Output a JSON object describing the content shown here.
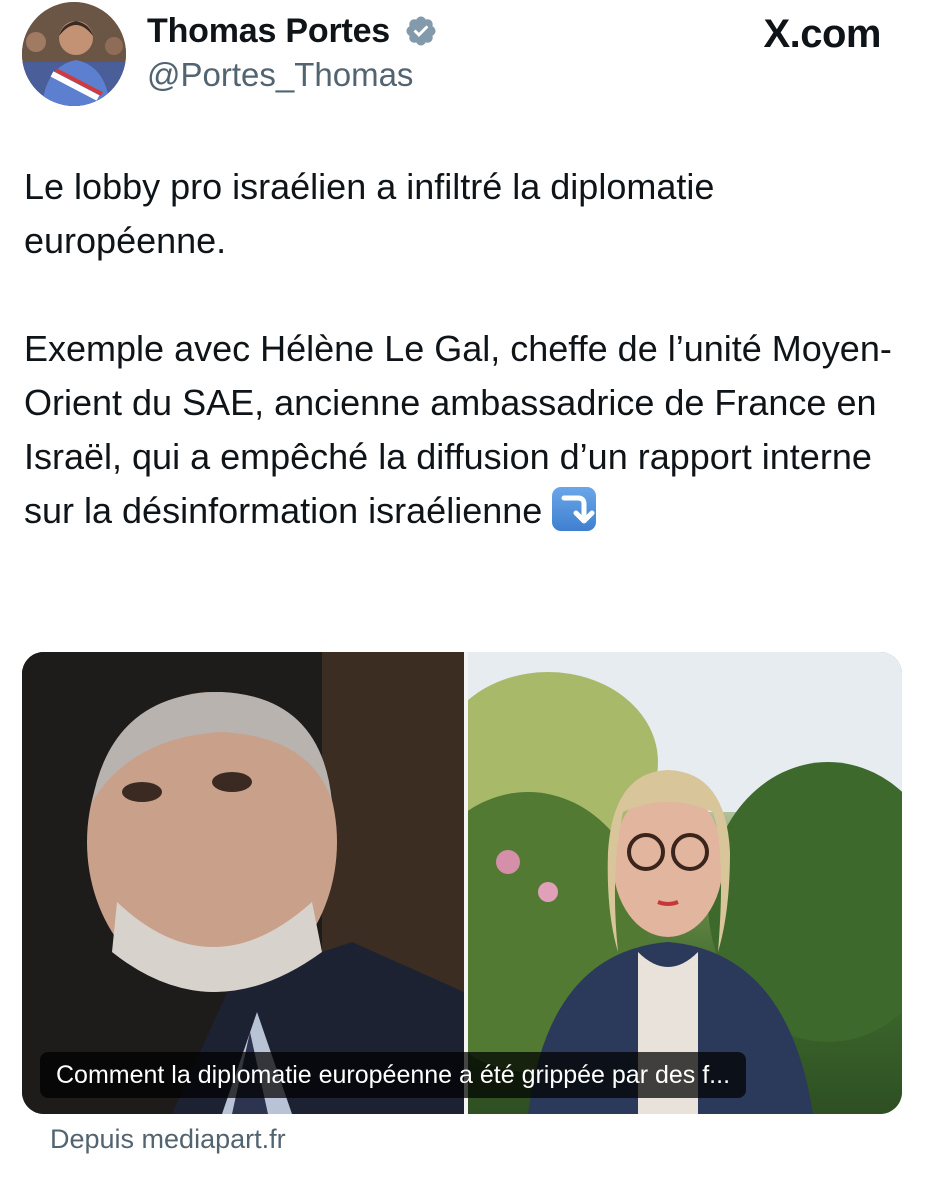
{
  "header": {
    "display_name": "Thomas Portes",
    "handle": "@Portes_Thomas",
    "site_logo": "X.com",
    "verified": true,
    "verified_icon": "verified-badge-icon"
  },
  "tweet": {
    "paragraph1": "Le lobby pro israélien a infiltré la diplomatie européenne.",
    "paragraph2": "Exemple avec Hélène Le Gal, cheffe de l’unité Moyen-Orient du SAE, ancienne ambassadrice de France en Israël, qui a empêché la diffusion d’un rapport interne sur la désinformation israélienne",
    "trailing_emoji": "arrow-curving-down-emoji"
  },
  "link_card": {
    "caption": "Comment la diplomatie européenne a été grippée par des f...",
    "source": "Depuis mediapart.fr"
  },
  "colors": {
    "text_primary": "#0f1419",
    "text_secondary": "#536471",
    "caption_bg": "#000000"
  }
}
